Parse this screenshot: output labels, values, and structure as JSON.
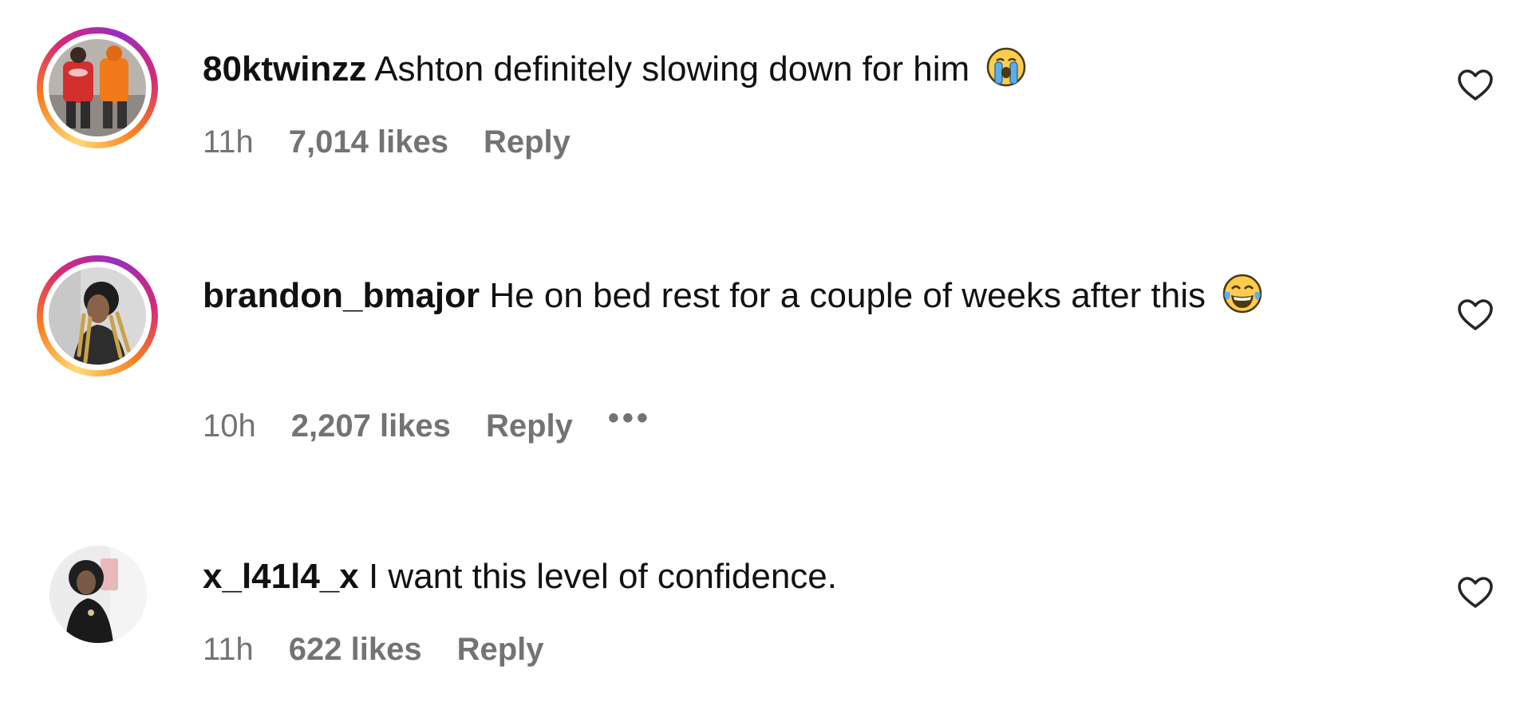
{
  "comments": [
    {
      "username": "80ktwinzz",
      "text": "Ashton definitely slowing down for him",
      "emoji": "loudly-crying-face",
      "time": "11h",
      "likes": "7,014 likes",
      "reply": "Reply",
      "has_story_ring": true
    },
    {
      "username": "brandon_bmajor",
      "text": "He on bed rest for a couple of weeks after this",
      "emoji": "face-with-tears-of-joy",
      "time": "10h",
      "likes": "2,207 likes",
      "reply": "Reply",
      "more": "•••",
      "has_story_ring": true
    },
    {
      "username": "x_l41l4_x",
      "text": "I want this level of confidence.",
      "time": "11h",
      "likes": "622 likes",
      "reply": "Reply",
      "has_story_ring": false
    }
  ],
  "icons": {
    "like": "heart-outline-icon"
  },
  "colors": {
    "text_primary": "#111111",
    "text_secondary": "#737373",
    "story_ring_gradient": [
      "#feda75",
      "#fa7e1e",
      "#d62976",
      "#962fbf"
    ]
  }
}
